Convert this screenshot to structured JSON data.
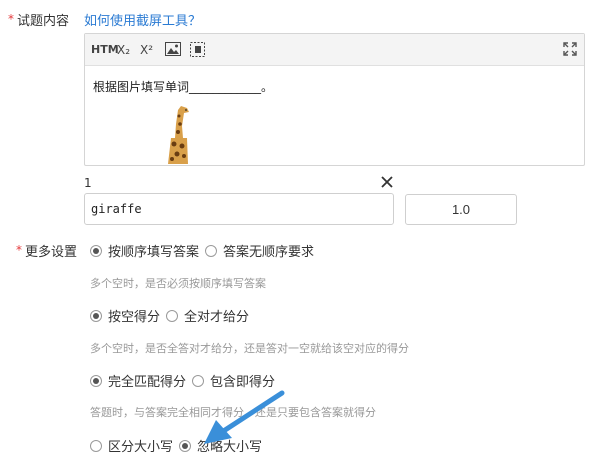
{
  "content_label": "试题内容",
  "required_mark": "*",
  "screenshot_help_link": "如何使用截屏工具？",
  "editor": {
    "toolbar": {
      "html": "HTM",
      "subscript": "X₂",
      "superscript": "X²",
      "image_icon": "image-icon",
      "blank_icon": "insert-blank-icon",
      "fullscreen_icon": "fullscreen-icon"
    },
    "text": "根据图片填写单词____________。",
    "image": "giraffe"
  },
  "blank": {
    "number": "1",
    "answer": "giraffe",
    "score": "1.0"
  },
  "more_settings": {
    "label": "更多设置",
    "order": {
      "option_a": "按顺序填写答案",
      "option_b": "答案无顺序要求",
      "selected": "a",
      "hint": "多个空时，是否必须按顺序填写答案"
    },
    "scoring": {
      "option_a": "按空得分",
      "option_b": "全对才给分",
      "selected": "a",
      "hint": "多个空时，是否全答对才给分，还是答对一空就给该空对应的得分"
    },
    "match": {
      "option_a": "完全匹配得分",
      "option_b": "包含即得分",
      "selected": "a",
      "hint": "答题时，与答案完全相同才得分，还是只要包含答案就得分"
    },
    "case": {
      "option_a": "区分大小写",
      "option_b": "忽略大小写",
      "selected": "b"
    }
  },
  "colors": {
    "link": "#2b7bd3",
    "required": "#e4393c",
    "arrow": "#3a8fd9"
  }
}
